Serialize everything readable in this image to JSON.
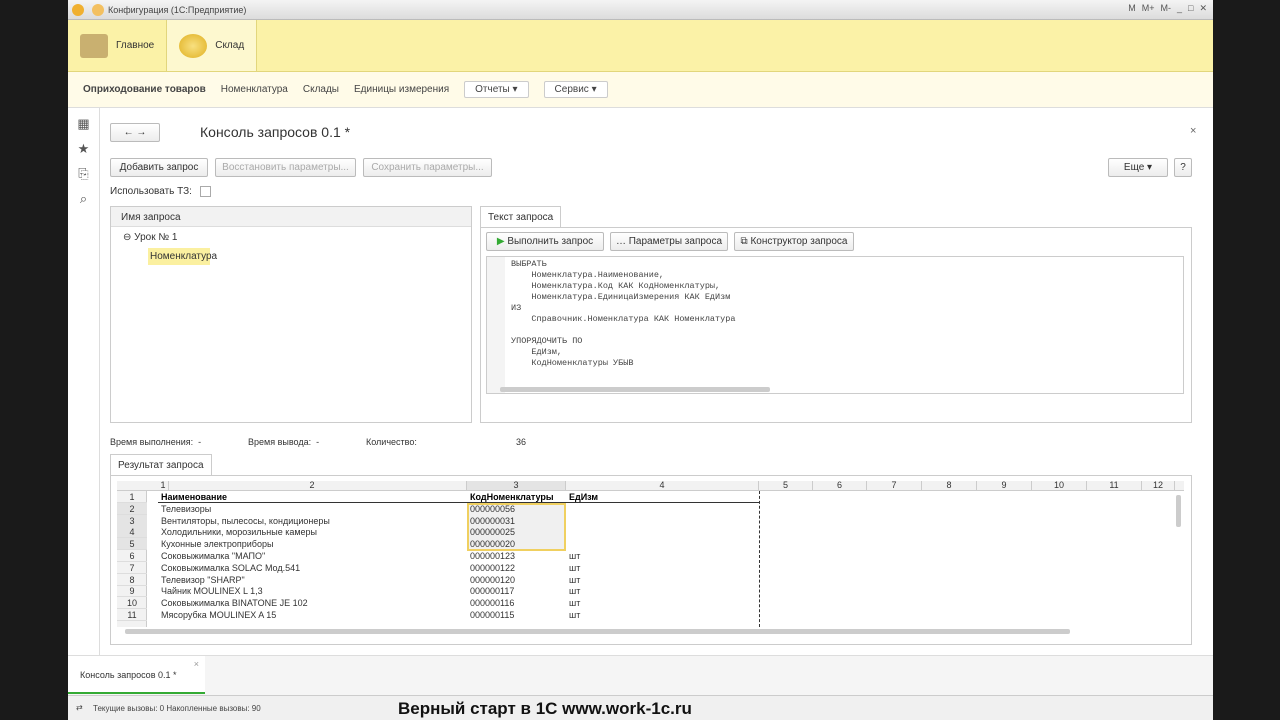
{
  "window": {
    "title": "Конфигурация (1С:Предприятие)",
    "controls": [
      "M",
      "M+",
      "M-"
    ]
  },
  "ribbon": {
    "sections": [
      {
        "label": "Главное"
      },
      {
        "label": "Склад"
      }
    ]
  },
  "menu": {
    "items": [
      "Оприходование товаров",
      "Номенклатура",
      "Склады",
      "Единицы измерения"
    ],
    "reports": "Отчеты",
    "service": "Сервис"
  },
  "form": {
    "title": "Консоль запросов 0.1  *",
    "add": "Добавить запрос",
    "restore": "Восстановить параметры...",
    "save": "Сохранить параметры...",
    "more": "Еще",
    "help": "?",
    "use_tz": "Использовать ТЗ:"
  },
  "tree": {
    "header": "Имя запроса",
    "root": "Урок № 1",
    "child": "Номенклатура"
  },
  "query": {
    "tab": "Текст запроса",
    "run": "Выполнить запрос",
    "params": "Параметры запроса",
    "constructor": "Конструктор запроса",
    "text": "ВЫБРАТЬ\n    Номенклатура.Наименование,\n    Номенклатура.Код КАК КодНоменклатуры,\n    Номенклатура.ЕдиницаИзмерения КАК ЕдИзм\nИЗ\n    Справочник.Номенклатура КАК Номенклатура\n\nУПОРЯДОЧИТЬ ПО\n    ЕдИзм,\n    КодНоменклатуры УБЫВ"
  },
  "stats": {
    "exec_label": "Время выполнения:",
    "exec": "-",
    "out_label": "Время вывода:",
    "out": "-",
    "count_label": "Количество:",
    "count": "36"
  },
  "result": {
    "tab": "Результат запроса",
    "col_numbers": [
      "1",
      "2",
      "3",
      "4",
      "5",
      "6",
      "7",
      "8",
      "9",
      "10",
      "11",
      "12"
    ],
    "rows": [
      [
        "1",
        "Наименование",
        "КодНоменклатуры",
        "ЕдИзм"
      ],
      [
        "2",
        "Телевизоры",
        "000000056",
        ""
      ],
      [
        "3",
        "Вентиляторы, пылесосы, кондиционеры",
        "000000031",
        ""
      ],
      [
        "4",
        "Холодильники, морозильные камеры",
        "000000025",
        ""
      ],
      [
        "5",
        "Кухонные электроприборы",
        "000000020",
        ""
      ],
      [
        "6",
        "Соковыжималка \"МАПО\"",
        "000000123",
        "шт"
      ],
      [
        "7",
        "Соковыжималка  SOLAC  Мод.541",
        "000000122",
        "шт"
      ],
      [
        "8",
        "Телевизор \"SHARP\"",
        "000000120",
        "шт"
      ],
      [
        "9",
        "Чайник MOULINEX L 1,3",
        "000000117",
        "шт"
      ],
      [
        "10",
        "Соковыжималка  BINATONE JE 102",
        "000000116",
        "шт"
      ],
      [
        "11",
        "Мясорубка MOULINEX  A 15",
        "000000115",
        "шт"
      ]
    ]
  },
  "bottom": {
    "open_tab": "Консоль запросов 0.1  *",
    "status": "Текущие вызовы: 0   Накопленные вызовы: 90",
    "watermark": "Верный старт в 1С www.work-1c.ru"
  }
}
